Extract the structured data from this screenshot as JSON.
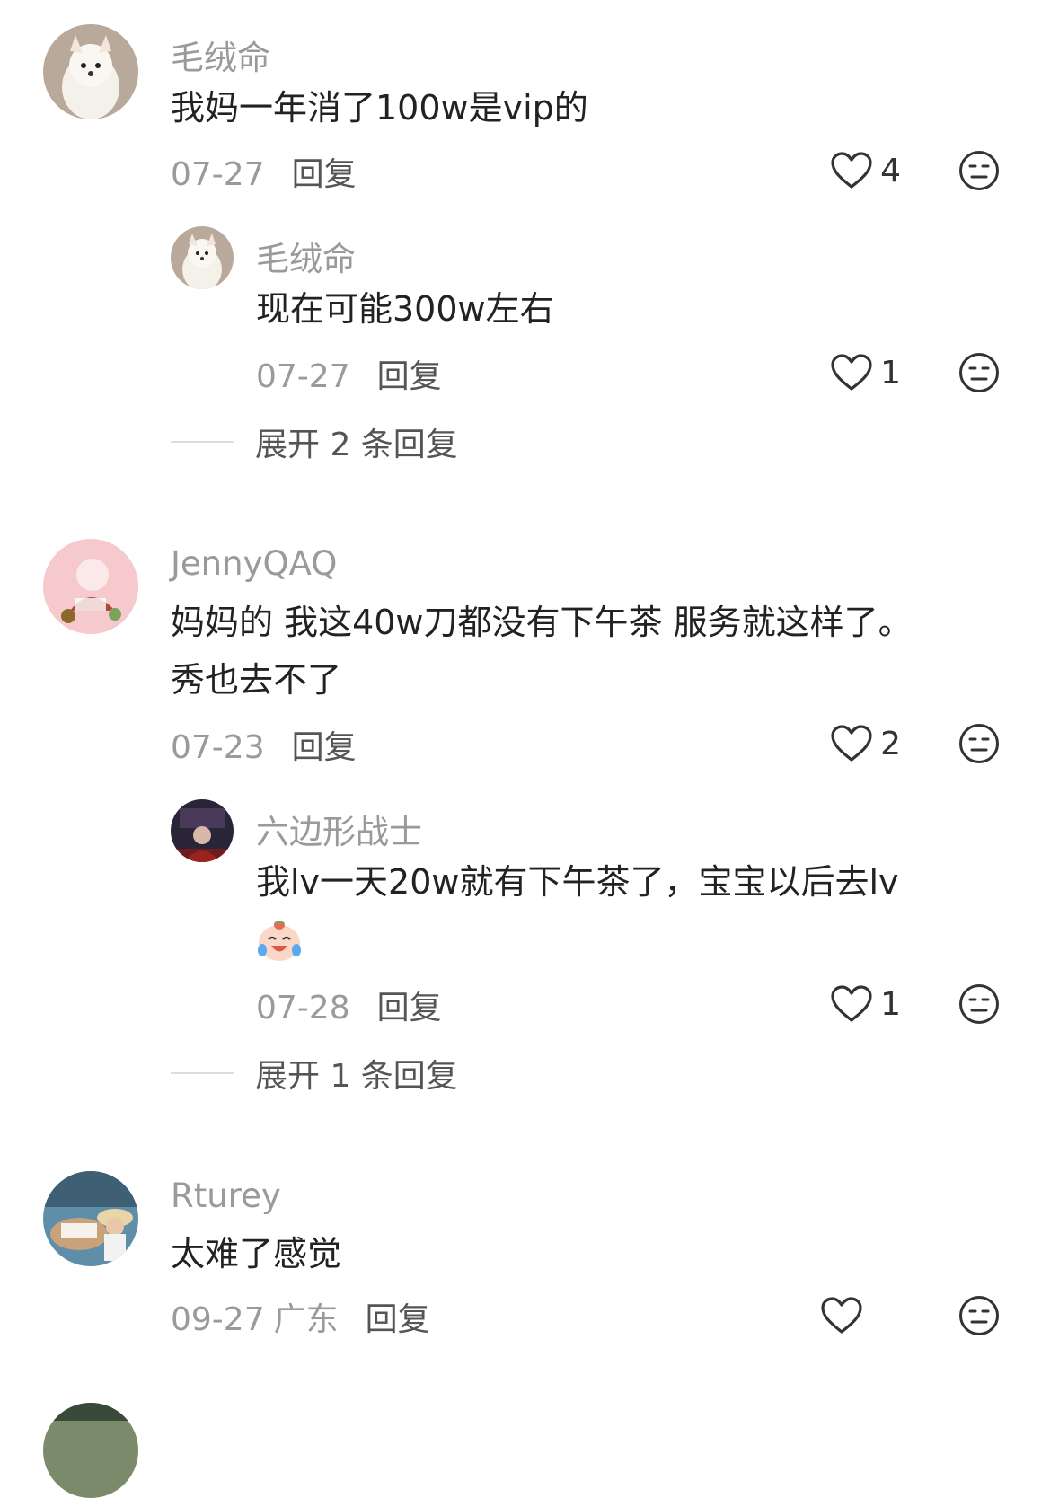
{
  "comments": [
    {
      "username": "毛绒命",
      "text": "我妈一年消了100w是vip的",
      "date": "07-27",
      "reply_label": "回复",
      "likes": "4",
      "replies": [
        {
          "username": "毛绒命",
          "text": "现在可能300w左右",
          "date": "07-27",
          "reply_label": "回复",
          "likes": "1"
        }
      ],
      "expand_label": "展开 2 条回复"
    },
    {
      "username": "JennyQAQ",
      "text_line1": "妈妈的 我这40w刀都没有下午茶 服务就这样了。",
      "text_line2": "秀也去不了",
      "date": "07-23",
      "reply_label": "回复",
      "likes": "2",
      "replies": [
        {
          "username": "六边形战士",
          "text": "我lv一天20w就有下午茶了，宝宝以后去lv",
          "date": "07-28",
          "reply_label": "回复",
          "likes": "1"
        }
      ],
      "expand_label": "展开 1 条回复"
    },
    {
      "username": "Rturey",
      "text": "太难了感觉",
      "date": "09-27",
      "location": "广东",
      "reply_label": "回复",
      "likes": ""
    }
  ]
}
